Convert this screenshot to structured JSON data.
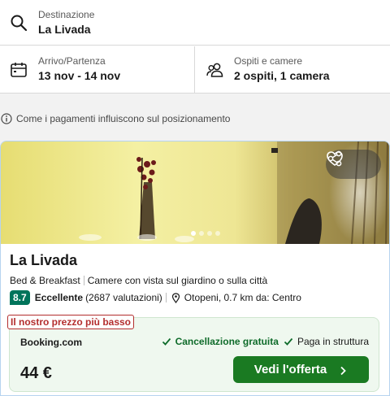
{
  "search": {
    "destination_label": "Destinazione",
    "destination_value": "La Livada",
    "dates_label": "Arrivo/Partenza",
    "dates_value": "13 nov - 14 nov",
    "guests_label": "Ospiti e camere",
    "guests_value": "2 ospiti, 1 camera"
  },
  "notice": {
    "text": "Come i pagamenti influiscono sul posizionamento"
  },
  "hotel": {
    "name": "La Livada",
    "type": "Bed & Breakfast",
    "room_note": "Camere con vista sul giardino o sulla città",
    "score": "8.7",
    "rating_word": "Eccellente",
    "reviews": "(2687 valutazioni)",
    "location": "Otopeni, 0.7 km da: Centro",
    "photo_count": 4,
    "active_photo": 1
  },
  "offer": {
    "badge": "Il nostro prezzo più basso",
    "provider": "Booking.com",
    "perk_1": "Cancellazione gratuita",
    "perk_2": "Paga in struttura",
    "price": "44 €",
    "cta_label": "Vedi l'offerta"
  },
  "icons": {
    "search": "search-icon",
    "calendar": "calendar-icon",
    "guests": "people-icon",
    "info": "info-icon",
    "share": "share-icon",
    "favorite": "heart-icon",
    "location": "pin-icon",
    "check": "check-icon",
    "arrow": "chevron-right-icon"
  },
  "colors": {
    "score_bg": "#00745b",
    "cta_bg": "#1a7a22",
    "badge_border": "#b32d2d",
    "offer_bg": "#eff8ef"
  }
}
